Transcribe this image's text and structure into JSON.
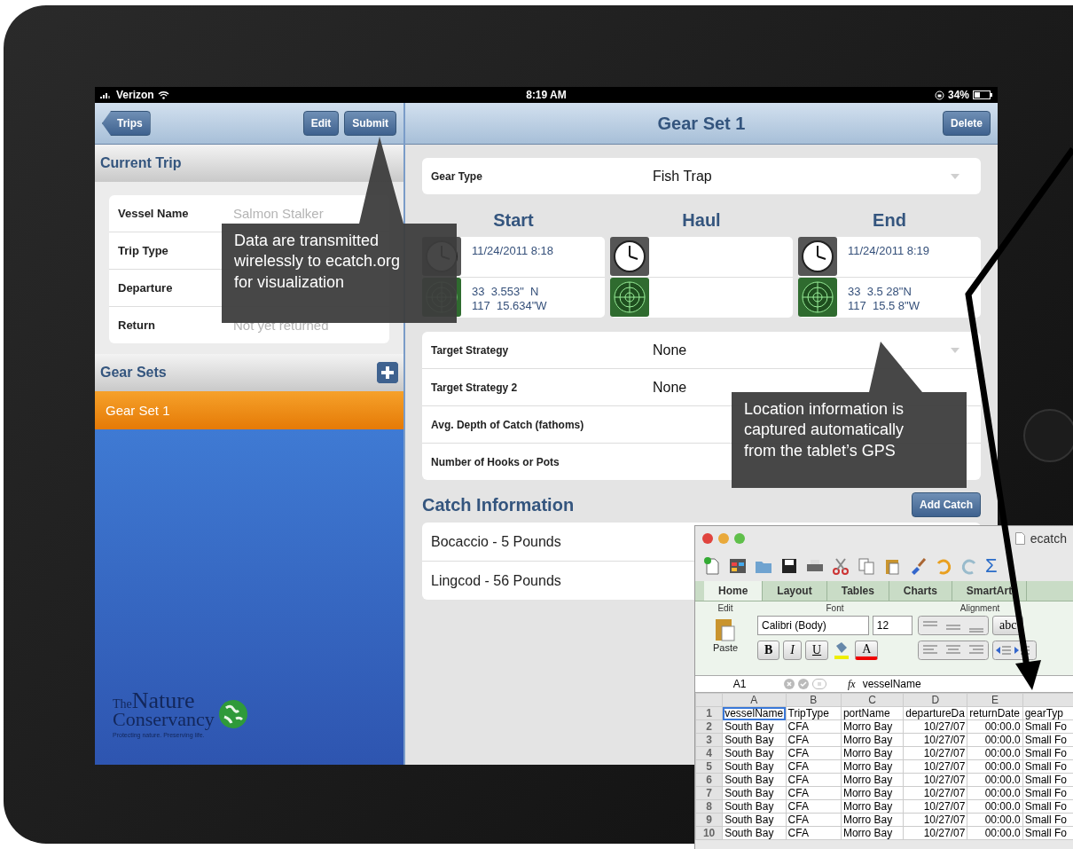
{
  "status_bar": {
    "carrier": "Verizon",
    "time": "8:19 AM",
    "battery": "34%"
  },
  "left_nav": {
    "back": "Trips",
    "buttons": [
      "Edit",
      "Submit"
    ]
  },
  "current_trip": {
    "title": "Current Trip",
    "fields": [
      {
        "label": "Vessel Name",
        "placeholder": "Salmon Stalker"
      },
      {
        "label": "Trip Type"
      },
      {
        "label": "Departure"
      },
      {
        "label": "Return",
        "placeholder": "Not yet returned"
      }
    ]
  },
  "gear_sets": {
    "title": "Gear Sets",
    "items": [
      {
        "label": "Gear Set 1",
        "selected": true
      }
    ]
  },
  "logo": {
    "small": "The",
    "large": "Nature",
    "second": "Conservancy",
    "tagline": "Protecting nature. Preserving life."
  },
  "detail": {
    "title": "Gear Set 1",
    "delete": "Delete",
    "gear_type": {
      "label": "Gear Type",
      "value": "Fish Trap"
    },
    "events": [
      {
        "heading": "Start",
        "time": "11/24/2011 8:18",
        "lat": "33  3.553\"  N",
        "lon": "117  15.634\"W"
      },
      {
        "heading": "Haul"
      },
      {
        "heading": "End",
        "time": "11/24/2011 8:19",
        "lat": "33  3.5 28\"N",
        "lon": "117  15.5 8\"W"
      }
    ],
    "fields": [
      {
        "label": "Target Strategy",
        "value": "None",
        "kind": "dropdown"
      },
      {
        "label": "Target Strategy 2",
        "value": "None",
        "kind": "text"
      },
      {
        "label": "Avg. Depth of Catch (fathoms)",
        "kind": "text"
      },
      {
        "label": "Number of Hooks or Pots",
        "kind": "text"
      }
    ],
    "catch": {
      "title": "Catch Information",
      "add_button": "Add Catch",
      "items": [
        "Bocaccio - 5 Pounds",
        "Lingcod - 56 Pounds"
      ]
    }
  },
  "callouts": [
    {
      "lines": [
        "Data are transmitted",
        "wirelessly to ecatch.org",
        "for visualization"
      ]
    },
    {
      "lines": [
        "Location information is",
        "captured automatically",
        "from the tablet’s GPS"
      ]
    }
  ],
  "spreadsheet": {
    "title": "ecatch",
    "tabs": [
      {
        "label": "Home",
        "selected": true
      },
      {
        "label": "Layout",
        "selected": false
      },
      {
        "label": "Tables",
        "selected": false
      },
      {
        "label": "Charts",
        "selected": false
      },
      {
        "label": "SmartArt",
        "selected": false
      }
    ],
    "groups": [
      "Edit",
      "Font",
      "Alignment"
    ],
    "paste": "Paste",
    "font": "Calibri (Body)",
    "size": "12",
    "format_buttons": [
      "B",
      "I",
      "U"
    ],
    "color_glyph": "A",
    "wrap": "abc",
    "sum_glyph": "Σ",
    "name_box": "A1",
    "fx": "fx",
    "formula": "vesselName",
    "columns": [
      "A",
      "B",
      "C",
      "D",
      "E"
    ],
    "rows": [
      {
        "number": "1",
        "cells": [
          "vesselName",
          "TripType",
          "portName",
          "departureDa",
          "returnDate",
          "gearTyp"
        ]
      },
      {
        "number": "2",
        "cells": [
          "South Bay",
          "CFA",
          "Morro Bay",
          "10/27/07",
          "00:00.0",
          "Small Fo"
        ]
      },
      {
        "number": "3",
        "cells": [
          "South Bay",
          "CFA",
          "Morro Bay",
          "10/27/07",
          "00:00.0",
          "Small Fo"
        ]
      },
      {
        "number": "4",
        "cells": [
          "South Bay",
          "CFA",
          "Morro Bay",
          "10/27/07",
          "00:00.0",
          "Small Fo"
        ]
      },
      {
        "number": "5",
        "cells": [
          "South Bay",
          "CFA",
          "Morro Bay",
          "10/27/07",
          "00:00.0",
          "Small Fo"
        ]
      },
      {
        "number": "6",
        "cells": [
          "South Bay",
          "CFA",
          "Morro Bay",
          "10/27/07",
          "00:00.0",
          "Small Fo"
        ]
      },
      {
        "number": "7",
        "cells": [
          "South Bay",
          "CFA",
          "Morro Bay",
          "10/27/07",
          "00:00.0",
          "Small Fo"
        ]
      },
      {
        "number": "8",
        "cells": [
          "South Bay",
          "CFA",
          "Morro Bay",
          "10/27/07",
          "00:00.0",
          "Small Fo"
        ]
      },
      {
        "number": "9",
        "cells": [
          "South Bay",
          "CFA",
          "Morro Bay",
          "10/27/07",
          "00:00.0",
          "Small Fo"
        ]
      },
      {
        "number": "10",
        "cells": [
          "South Bay",
          "CFA",
          "Morro Bay",
          "10/27/07",
          "00:00.0",
          "Small Fo"
        ]
      }
    ]
  }
}
